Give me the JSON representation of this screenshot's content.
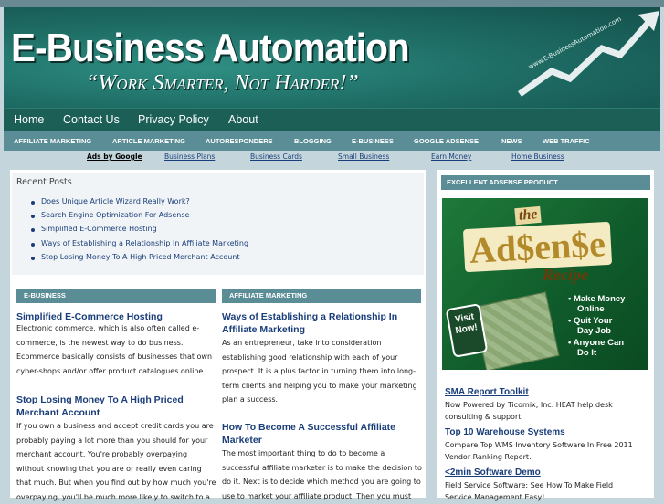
{
  "header": {
    "title": "E-Business Automation",
    "slogan_quote_open": "“",
    "slogan_w1": "Work",
    "slogan_w2": "Smarter,",
    "slogan_w3": "Not",
    "slogan_w4": "Harder!",
    "slogan_quote_close": "”",
    "url": "www.E-BusinessAutomation.com"
  },
  "nav_main": [
    "Home",
    "Contact Us",
    "Privacy Policy",
    "About"
  ],
  "nav_categories": [
    "AFFILIATE MARKETING",
    "ARTICLE MARKETING",
    "AUTORESPONDERS",
    "BLOGGING",
    "E-BUSINESS",
    "GOOGLE ADSENSE",
    "NEWS",
    "WEB TRAFFIC"
  ],
  "ads_bar": {
    "lead": "Ads by Google",
    "links": [
      "Business Plans",
      "Business Cards",
      "Small Business",
      "Earn Money",
      "Home Business"
    ]
  },
  "recent_posts": {
    "title": "Recent Posts",
    "items": [
      "Does Unique Article Wizard Really Work?",
      "Search Engine Optimization For Adsense",
      "Simplified E-Commerce Hosting",
      "Ways of Establishing a Relationship In Affiliate Marketing",
      "Stop Losing Money To A High Priced Merchant Account"
    ]
  },
  "col_left": {
    "heading": "E-BUSINESS",
    "post1_title": "Simplified E-Commerce Hosting",
    "post1_body": [
      "Electronic commerce, which is also often called e-",
      "commerce, is the newest way to do business.",
      "Ecommerce basically consists of businesses that own",
      "cyber-shops and/or offer product catalogues online."
    ],
    "post2_title": [
      "Stop Losing Money To A High Priced",
      "Merchant Account"
    ],
    "post2_body": [
      "If you own a business and accept credit cards you are",
      "probably paying a lot more than you should for your",
      "merchant account. You're probably overpaying",
      "without knowing that you are or really even caring",
      "that much. But when you find out by how much you're",
      "overpaying, you'll be much more likely to switch to a"
    ]
  },
  "col_right": {
    "heading": "AFFILIATE MARKETING",
    "post1_title": [
      "Ways of Establishing a Relationship In",
      "Affiliate Marketing"
    ],
    "post1_body": [
      "As an entrepreneur, take into consideration",
      "establishing good relationship with each of your",
      "prospect. It is a plus factor in turning them into long-",
      "term clients and helping you to make your marketing",
      "plan a success."
    ],
    "post2_title": [
      "How To Become A Successful Affiliate",
      "Marketer"
    ],
    "post2_body": [
      "The most important thing to do to become a",
      "successful affiliate marketer is to make the decision to",
      "do it. Next is to decide which method you are going to",
      "use to market your affiliate product. Then you must"
    ]
  },
  "sidebar": {
    "heading": "EXCELLENT ADSENSE PRODUCT",
    "book": {
      "the": "the",
      "adsense": "Ad$en$e",
      "recipe": "Recipe",
      "bullets": [
        "• Make Money",
        "  Online",
        "• Quit Your",
        "  Day Job",
        "• Anyone Can",
        "  Do It"
      ],
      "visit": "Visit Now!"
    },
    "ads": [
      {
        "title": "SMA Report Toolkit",
        "text": [
          "Now Powered by Ticomix, Inc. HEAT help desk",
          "consulting & support"
        ]
      },
      {
        "title": "Top 10 Warehouse Systems",
        "text": [
          "Compare Top WMS Inventory Software In Free 2011",
          "Vendor Ranking Report."
        ]
      },
      {
        "title": "<2min Software Demo",
        "text": [
          "Field Service Software: See How To Make Field",
          "Service Management Easy!"
        ]
      }
    ]
  },
  "colors": {
    "header_bg": "#1f6f67",
    "nav_bg": "#1b5f57",
    "subnav_bg": "#5a8d95",
    "link": "#1a3e7a",
    "page_bg": "#c4d6dc"
  }
}
